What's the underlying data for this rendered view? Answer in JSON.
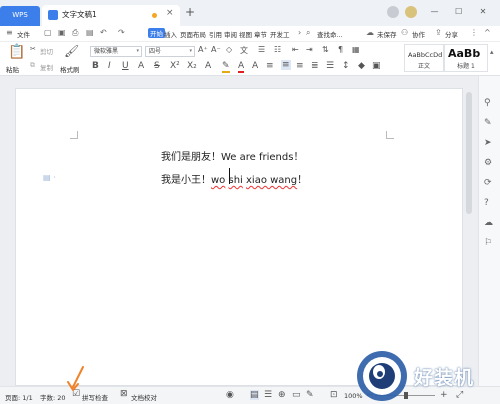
{
  "titlebar": {
    "app_tab": "WPS",
    "doc_tab": "文字文稿1",
    "new_tab": "+",
    "close_glyph": "×"
  },
  "menu": {
    "file": "文件",
    "start": "开始",
    "insert": "插入",
    "layout": "页面布局",
    "reference": "引用",
    "review": "审阅",
    "view": "视图",
    "section": "章节",
    "developer": "开发工",
    "search": "查找命...",
    "unsaved": "未保存",
    "collaborate": "协作",
    "share": "分享"
  },
  "ribbon": {
    "paste": "粘贴",
    "cut": "剪切",
    "copy": "复制",
    "format_painter": "格式刷",
    "font_name": "微软雅黑",
    "font_size": "四号",
    "style_normal_sample": "AaBbCcDd",
    "style_normal": "正文",
    "style_heading1_sample": "AaBb",
    "style_heading1": "标题 1"
  },
  "document": {
    "line1": "我们是朋友！We are friends！",
    "line2_prefix": "我是小王！",
    "line2_word1": "wo",
    "line2_word2": "shi",
    "line2_rest": "xiao wang",
    "line2_end": "！"
  },
  "status": {
    "page": "页面: 1/1",
    "word_count": "字数: 20",
    "spellcheck": "拼写检查",
    "proofread": "文档校对",
    "zoom": "100%"
  },
  "watermark": {
    "text": "好装机"
  },
  "colors": {
    "accent": "#3d7fea",
    "arrow": "#f0822a",
    "spell_error": "#ee3333"
  }
}
